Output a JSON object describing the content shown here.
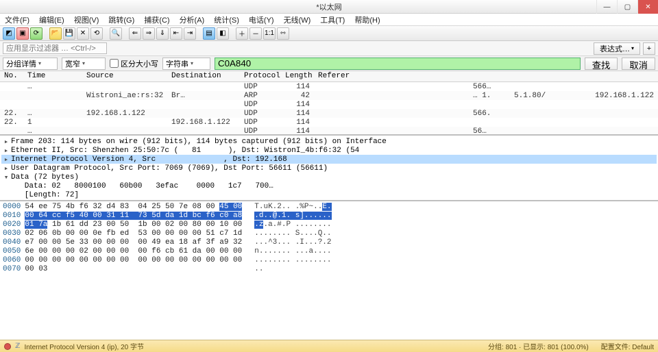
{
  "window": {
    "title": "*以太网",
    "min": "—",
    "max": "▢",
    "close": "✕"
  },
  "menu": {
    "file": "文件(F)",
    "edit": "编辑(E)",
    "view": "视图(V)",
    "go": "跳转(G)",
    "capture": "捕获(C)",
    "analyze": "分析(A)",
    "statistics": "统计(S)",
    "telephony": "电话(Y)",
    "wireless": "无线(W)",
    "tools": "工具(T)",
    "help": "帮助(H)"
  },
  "filterbar": {
    "placeholder": "应用显示过滤器 … <Ctrl-/>",
    "expression": "表达式…",
    "plus": "+"
  },
  "searchbar": {
    "combo1": "分组详情",
    "combo2": "宽窄",
    "case": "区分大小写",
    "combo3": "字符串",
    "value": "C0A840",
    "find": "查找",
    "cancel": "取消"
  },
  "packet_list": {
    "headers": {
      "no": "No.",
      "time": "Time",
      "src": "Source",
      "dst": "Destination",
      "proto": "Protocol",
      "len": "Length",
      "info": "Referer"
    },
    "rows": [
      {
        "no": "",
        "time": "     …",
        "src": "",
        "dst": "",
        "proto": "UDP",
        "len": "114",
        "info": "",
        "e1": "566…",
        "e2": "",
        "e3": ""
      },
      {
        "no": "",
        "time": "",
        "src": "Wistroni_ae:rs:32",
        "dst": "Br…",
        "proto": "ARP",
        "len": "42",
        "info": "",
        "e1": "… 1.",
        "e2": "5.1.80/",
        "e3": "192.168.1.122"
      },
      {
        "no": "",
        "time": "",
        "src": "",
        "dst": "",
        "proto": "UDP",
        "len": "114",
        "info": "",
        "e1": "",
        "e2": "",
        "e3": ""
      },
      {
        "no": "22.",
        "time": "    …",
        "src": "192.168.1.122",
        "dst": "",
        "proto": "UDP",
        "len": "114",
        "info": "",
        "e1": "566.",
        "e2": "",
        "e3": ""
      },
      {
        "no": "22.",
        "time": "     1",
        "src": "",
        "dst": "192.168.1.122",
        "proto": "UDP",
        "len": "114",
        "info": "",
        "e1": "",
        "e2": "",
        "e3": ""
      },
      {
        "no": "",
        "time": "   …",
        "src": "",
        "dst": "",
        "proto": "UDP",
        "len": "114",
        "info": "",
        "e1": "56…",
        "e2": "",
        "e3": ""
      }
    ]
  },
  "details": {
    "r0": "Frame 203: 114 bytes on wire (912 bits), 114 bytes captured (912 bits) on Interface",
    "r1": "Ethernet II, Src: Shenzhen 25:50:7c (   81      ), Dst: WistronI_4b:f6:32 (54",
    "r2": "Internet Protocol Version 4, Src               , Dst: 192.168",
    "r3": "User Datagram Protocol, Src Port: 7069 (7069), Dst Port: 56611 (56611)",
    "r4": "Data (72 bytes)",
    "r5": "   Data: 02   8000100   60b00   3efac    0000   1c7   700…",
    "r6": "   [Length: 72]"
  },
  "hex": {
    "rows": [
      {
        "off": "0000",
        "b": "54 ee 75 4b f6 32 d4 83  04 25 50 7e 08 00 ",
        "sel": "45 00",
        "a": "T.uK.2.. .%P~..",
        "asel": "E."
      },
      {
        "off": "0010",
        "b": "",
        "sel": "00 64 cc f5 40 00 31 11  73 5d da 1d bc f6 c0 a8",
        "a": "",
        "asel": ".d..@.1. s]......"
      },
      {
        "off": "0020",
        "b": "",
        "sel": "01 7a",
        "b2": " 1b 61 dd 23 00 50  1b 00 02 00 80 00 10 00",
        "a": "",
        "asel": ".z",
        "a2": ".a.#.P ........"
      },
      {
        "off": "0030",
        "b": "02 06 0b 00 00 0e fb ed  53 00 00 00 00 51 c7 1d",
        "a": "........ S....Q.."
      },
      {
        "off": "0040",
        "b": "e7 00 00 5e 33 00 00 00  00 49 ea 18 af 3f a9 32",
        "a": "...^3... .I...?.2"
      },
      {
        "off": "0050",
        "b": "6e 00 00 00 02 00 00 00  00 f6 cb 61 da 00 00 00",
        "a": "n....... ...a...."
      },
      {
        "off": "0060",
        "b": "00 00 00 00 00 00 00 00  00 00 00 00 00 00 00 00",
        "a": "........ ........"
      },
      {
        "off": "0070",
        "b": "00 03",
        "a": ".."
      }
    ]
  },
  "status": {
    "left": "Internet Protocol Version 4 (ip), 20 字节",
    "r1": "分组: 801 · 已显示: 801 (100.0%)",
    "r2": "配置文件: Default"
  },
  "icons": {
    "tri_r": "▸",
    "tri_d": "▾",
    "dropdown": "▾"
  }
}
